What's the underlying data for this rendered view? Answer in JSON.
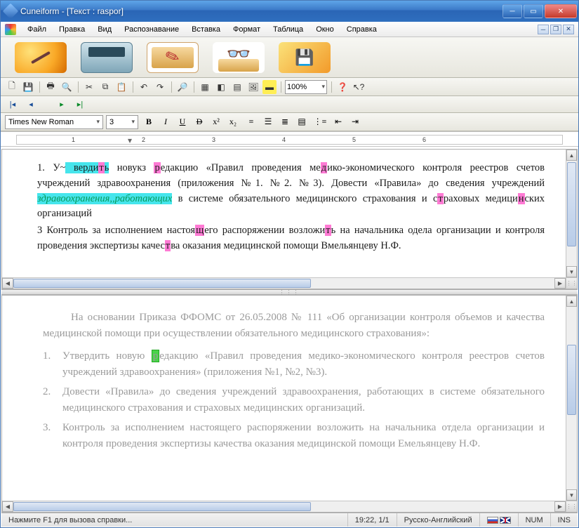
{
  "title": "Cuneiform - [Текст : raspor]",
  "menu": [
    "Файл",
    "Правка",
    "Вид",
    "Распознавание",
    "Вставка",
    "Формат",
    "Таблица",
    "Окно",
    "Справка"
  ],
  "zoom": "100%",
  "font": {
    "name": "Times New Roman",
    "size": "3"
  },
  "ruler_numbers": [
    "1",
    "2",
    "3",
    "4",
    "5",
    "6"
  ],
  "doc_top": {
    "p1a": "1. У~",
    "p1b": " верди",
    "p1c": "т",
    "p1d": "ь",
    "p1e": " новукз ",
    "p1f": "р",
    "p1g": "едакцию «Правил проведения ме",
    "p1h": "д",
    "p1i": "ико-экономического контроля реестров счетов учреждений здравоохранения (приложения №1. №2. №3). Довести «Правила» до сведения учреждений ",
    "p1j": "здравоохранения,,работающих",
    "p1k": " в системе обязательного медицинского страхования и с",
    "p1l": "т",
    "p1m": "раховых медици",
    "p1n": "н",
    "p1o": "ских организаций",
    "p2a": "3 Контроль за исполнением настоя",
    "p2b": "щ",
    "p2c": "его распоряжении возложи",
    "p2d": "т",
    "p2e": "ь на начальника одела организации и контроля проведения экспертизы качес",
    "p2f": "т",
    "p2g": "ва оказания медицинской помощи Вмельянцеву Н.Ф."
  },
  "doc_bottom": {
    "intro": "На основании Приказа ФФОМС от 26.05.2008 № 111 «Об организации контроля объемов и качества медицинской помощи при осуществлении обязательного медицинского страхования»:",
    "li1a": "Утвердить новую ",
    "li1b": "р",
    "li1c": "едакцию «Правил проведения медико-экономического контроля реестров счетов учреждений здравоохранения» (приложения №1, №2, №3).",
    "li2": "Довести «Правила» до сведения учреждений здравоохранения, работающих в системе обязательного медицинского страхования и страховых медицинских организаций.",
    "li3": "Контроль за исполнением настоящего распоряжении возложить на начальника отдела организации и контроля проведения экспертизы качества оказания медицинской помощи Емельянцеву Н.Ф.",
    "n1": "1.",
    "n2": "2.",
    "n3": "3."
  },
  "status": {
    "hint": "Нажмите F1 для вызова справки...",
    "time_page": "19:22, 1/1",
    "lang": "Русско-Английский",
    "num": "NUM",
    "ins": "INS"
  },
  "fmt": {
    "B": "B",
    "I": "I",
    "U": "U",
    "D": "D",
    "x2": "x²",
    "x_2": "x₂"
  }
}
